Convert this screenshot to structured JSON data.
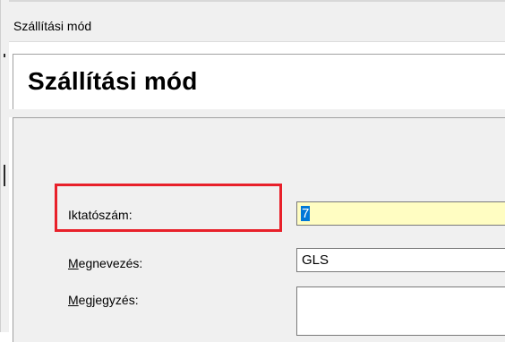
{
  "window": {
    "title": "Szállítási mód"
  },
  "header": {
    "title": "Szállítási mód"
  },
  "form": {
    "iktatoszam": {
      "label": "Iktatószám:",
      "value": "7",
      "highlight_color": "#e8202a"
    },
    "megnevezes": {
      "label_mnemonic": "M",
      "label_rest": "egnevezés:",
      "value": "GLS"
    },
    "megjegyzes": {
      "label_mnemonic": "M",
      "label_rest": "egjegyzés:",
      "value": ""
    }
  },
  "colors": {
    "selected_field_bg": "#fffdc2",
    "selection_bg": "#0078d7",
    "panel_bg": "#f0f0f0"
  }
}
